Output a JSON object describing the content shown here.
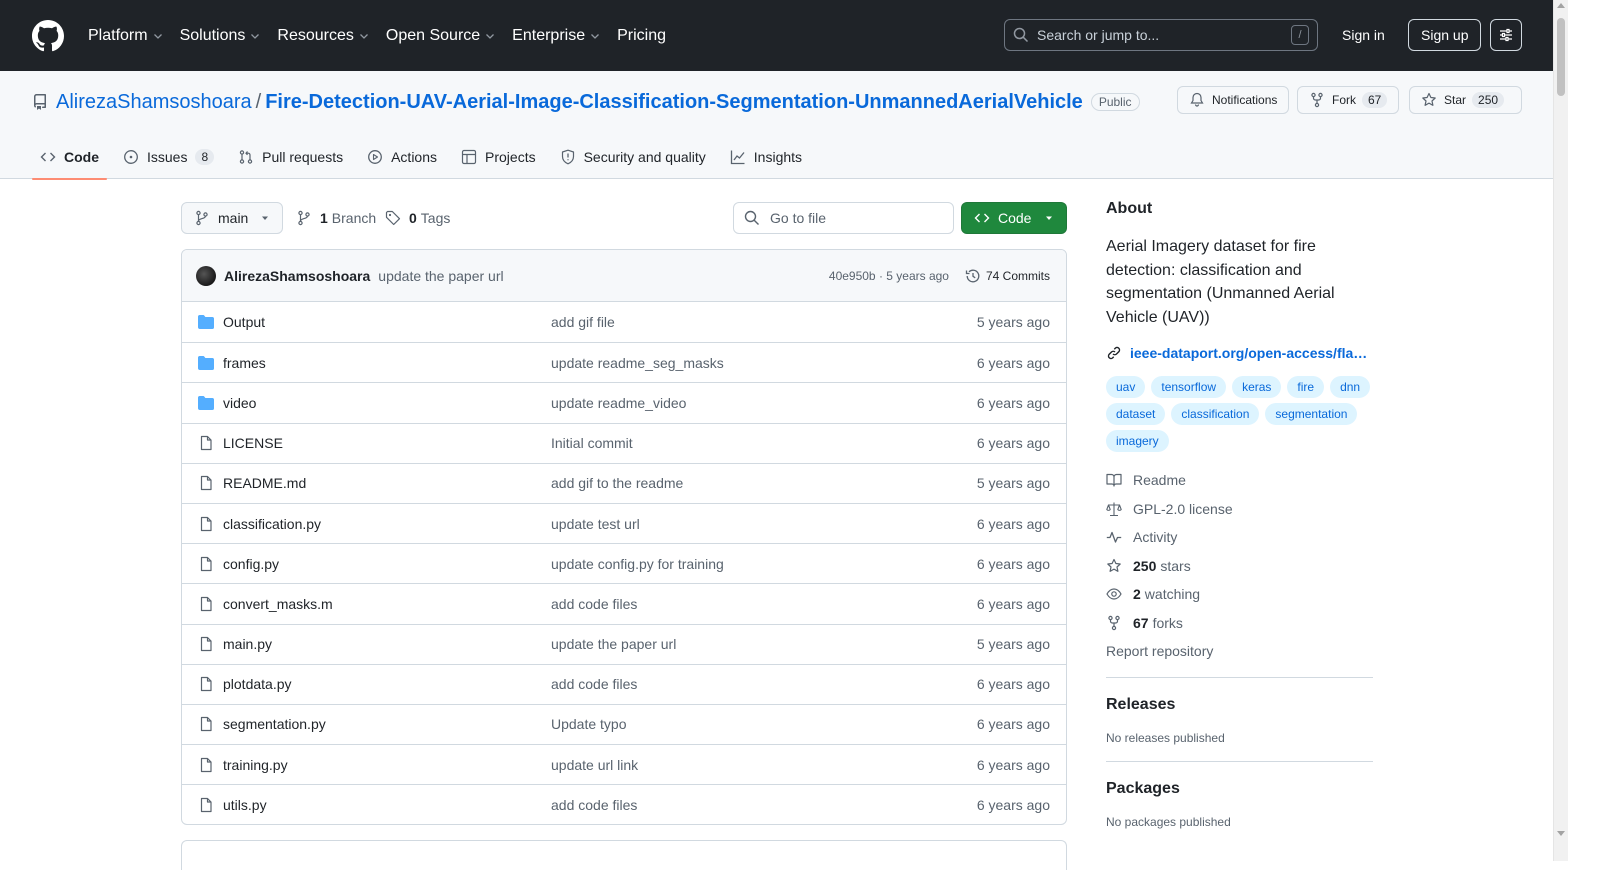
{
  "header": {
    "nav": [
      "Platform",
      "Solutions",
      "Resources",
      "Open Source",
      "Enterprise",
      "Pricing"
    ],
    "search_placeholder": "Search or jump to...",
    "search_shortcut": "/",
    "signin": "Sign in",
    "signup": "Sign up"
  },
  "repo": {
    "owner": "AlirezaShamsoshoara",
    "separator": "/",
    "name": "Fire-Detection-UAV-Aerial-Image-Classification-Segmentation-UnmannedAerialVehicle",
    "visibility": "Public",
    "notifications_label": "Notifications",
    "fork_label": "Fork",
    "fork_count": "67",
    "star_label": "Star",
    "star_count": "250"
  },
  "tabs": [
    {
      "label": "Code"
    },
    {
      "label": "Issues",
      "count": "8"
    },
    {
      "label": "Pull requests"
    },
    {
      "label": "Actions"
    },
    {
      "label": "Projects"
    },
    {
      "label": "Security and quality"
    },
    {
      "label": "Insights"
    }
  ],
  "toolbar": {
    "branch": "main",
    "branch_count": "1",
    "branch_label": "Branch",
    "tag_count": "0",
    "tag_label": "Tags",
    "goto_placeholder": "Go to file",
    "code_button": "Code"
  },
  "latest_commit": {
    "author": "AlirezaShamsoshoara",
    "message": "update the paper url",
    "meta": "40e950b · 5 years ago",
    "commits": "74 Commits"
  },
  "files": [
    {
      "name": "Output",
      "type": "dir",
      "message": "add gif file",
      "date": "5 years ago"
    },
    {
      "name": "frames",
      "type": "dir",
      "message": "update readme_seg_masks",
      "date": "6 years ago"
    },
    {
      "name": "video",
      "type": "dir",
      "message": "update readme_video",
      "date": "6 years ago"
    },
    {
      "name": "LICENSE",
      "type": "file",
      "message": "Initial commit",
      "date": "6 years ago"
    },
    {
      "name": "README.md",
      "type": "file",
      "message": "add gif to the readme",
      "date": "5 years ago"
    },
    {
      "name": "classification.py",
      "type": "file",
      "message": "update test url",
      "date": "6 years ago"
    },
    {
      "name": "config.py",
      "type": "file",
      "message": "update config.py for training",
      "date": "6 years ago"
    },
    {
      "name": "convert_masks.m",
      "type": "file",
      "message": "add code files",
      "date": "6 years ago"
    },
    {
      "name": "main.py",
      "type": "file",
      "message": "update the paper url",
      "date": "5 years ago"
    },
    {
      "name": "plotdata.py",
      "type": "file",
      "message": "add code files",
      "date": "6 years ago"
    },
    {
      "name": "segmentation.py",
      "type": "file",
      "message": "Update typo",
      "date": "6 years ago"
    },
    {
      "name": "training.py",
      "type": "file",
      "message": "update url link",
      "date": "6 years ago"
    },
    {
      "name": "utils.py",
      "type": "file",
      "message": "add code files",
      "date": "6 years ago"
    }
  ],
  "about": {
    "title": "About",
    "description": "Aerial Imagery dataset for fire detection: classification and segmentation (Unmanned Aerial Vehicle (UAV))",
    "link": "ieee-dataport.org/open-access/fla…",
    "topics": [
      "uav",
      "tensorflow",
      "keras",
      "fire",
      "dnn",
      "dataset",
      "classification",
      "segmentation",
      "imagery"
    ],
    "readme": "Readme",
    "license": "GPL-2.0 license",
    "activity": "Activity",
    "stars_count": "250",
    "stars_label": "stars",
    "watching_count": "2",
    "watching_label": "watching",
    "forks_count": "67",
    "forks_label": "forks",
    "report": "Report repository"
  },
  "releases": {
    "title": "Releases",
    "empty": "No releases published"
  },
  "packages": {
    "title": "Packages",
    "empty": "No packages published"
  },
  "colors": {
    "header_bg": "#1f2328",
    "link": "#0969da",
    "code_button": "#1f883d",
    "active_tab_underline": "#fd8c73",
    "folder_icon": "#54aeff"
  }
}
